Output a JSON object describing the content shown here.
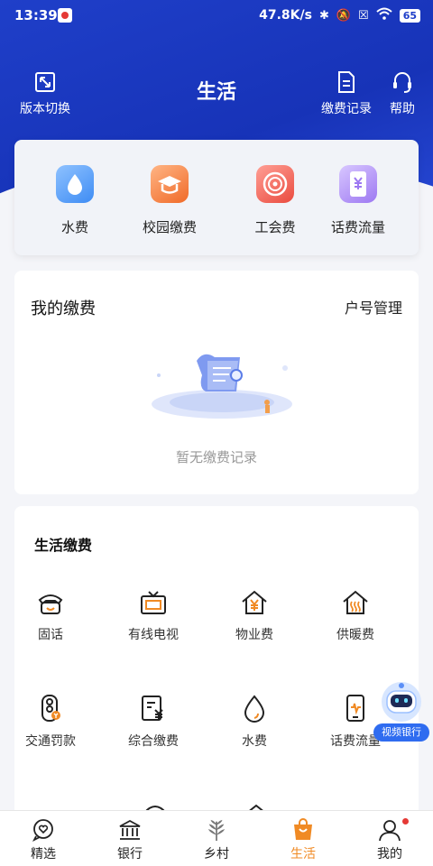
{
  "status_bar": {
    "time": "13:39",
    "speed": "47.8K/s",
    "battery": "65"
  },
  "header": {
    "title": "生活",
    "version_switch": "版本切换",
    "bill_record": "缴费记录",
    "help": "帮助"
  },
  "quick_actions": [
    {
      "label": "水费",
      "icon": "water-drop-icon"
    },
    {
      "label": "校园缴费",
      "icon": "graduation-cap-icon"
    },
    {
      "label": "工会费",
      "icon": "union-target-icon"
    },
    {
      "label": "话费流量",
      "icon": "phone-yuan-icon"
    }
  ],
  "my_payments": {
    "title": "我的缴费",
    "manage_link": "户号管理",
    "empty_text": "暂无缴费记录"
  },
  "life_payments": {
    "title": "生活缴费",
    "items": [
      {
        "label": "固话",
        "icon": "landline-phone-icon"
      },
      {
        "label": "有线电视",
        "icon": "tv-icon"
      },
      {
        "label": "物业费",
        "icon": "property-house-icon"
      },
      {
        "label": "供暖费",
        "icon": "heating-house-icon"
      },
      {
        "label": "交通罚款",
        "icon": "traffic-light-icon"
      },
      {
        "label": "综合缴费",
        "icon": "bill-yuan-icon"
      },
      {
        "label": "水费",
        "icon": "water-drop-icon"
      },
      {
        "label": "话费流量",
        "icon": "mobile-phone-icon"
      }
    ]
  },
  "video_bank": {
    "label": "视频银行"
  },
  "bottom_nav": [
    {
      "label": "精选",
      "icon": "heart-chat-icon",
      "active": false
    },
    {
      "label": "银行",
      "icon": "bank-icon",
      "active": false
    },
    {
      "label": "乡村",
      "icon": "wheat-icon",
      "active": false
    },
    {
      "label": "生活",
      "icon": "shopping-bag-icon",
      "active": true
    },
    {
      "label": "我的",
      "icon": "user-icon",
      "active": false
    }
  ],
  "colors": {
    "header_blue": "#1f3fc9",
    "active_orange": "#f08a24",
    "accent_blue": "#2f6cf0"
  }
}
